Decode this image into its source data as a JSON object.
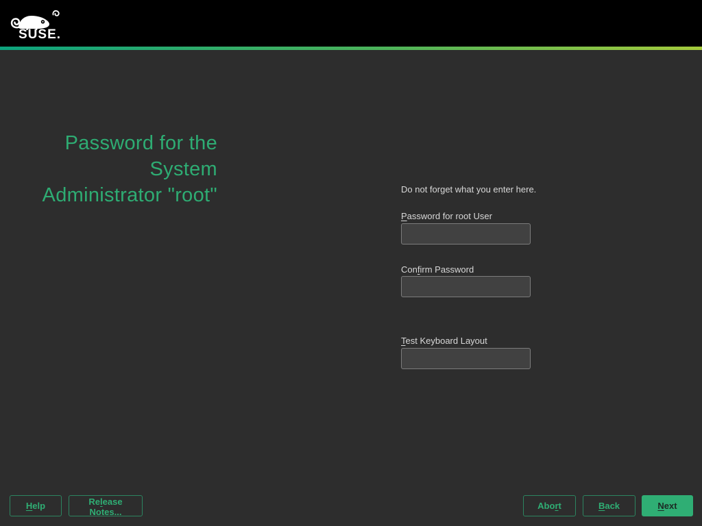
{
  "header": {
    "wordmark": "SUSE.",
    "logo_icon": "suse-chameleon-icon"
  },
  "colors": {
    "page_bg": "#2d2d2d",
    "header_bg": "#000000",
    "title_green": "#2eac73",
    "accent_green": "#2fae74",
    "button_border": "#2c8560",
    "gradient_left": "#0da37d",
    "gradient_right": "#a4ca3c",
    "input_bg": "#414141",
    "input_border": "#7d7d7d",
    "label_text": "#d8d8d8",
    "next_text": "#1c2b24"
  },
  "title": {
    "line1": "Password for the",
    "line2": "System",
    "line3": "Administrator \"root\""
  },
  "form": {
    "hint": "Do not forget what you enter here.",
    "fields": [
      {
        "label_pre": "",
        "label_key": "P",
        "label_post": "assword for root User",
        "value": ""
      },
      {
        "label_pre": "Con",
        "label_key": "f",
        "label_post": "irm Password",
        "value": ""
      },
      {
        "label_pre": "",
        "label_key": "T",
        "label_post": "est Keyboard Layout",
        "value": ""
      }
    ]
  },
  "buttons": {
    "help": {
      "pre": "",
      "key": "H",
      "post": "elp"
    },
    "release_notes": {
      "pre": "Re",
      "key": "l",
      "post": "ease Notes..."
    },
    "abort": {
      "pre": "Abo",
      "key": "r",
      "post": "t"
    },
    "back": {
      "pre": "",
      "key": "B",
      "post": "ack"
    },
    "next": {
      "pre": "",
      "key": "N",
      "post": "ext"
    }
  }
}
